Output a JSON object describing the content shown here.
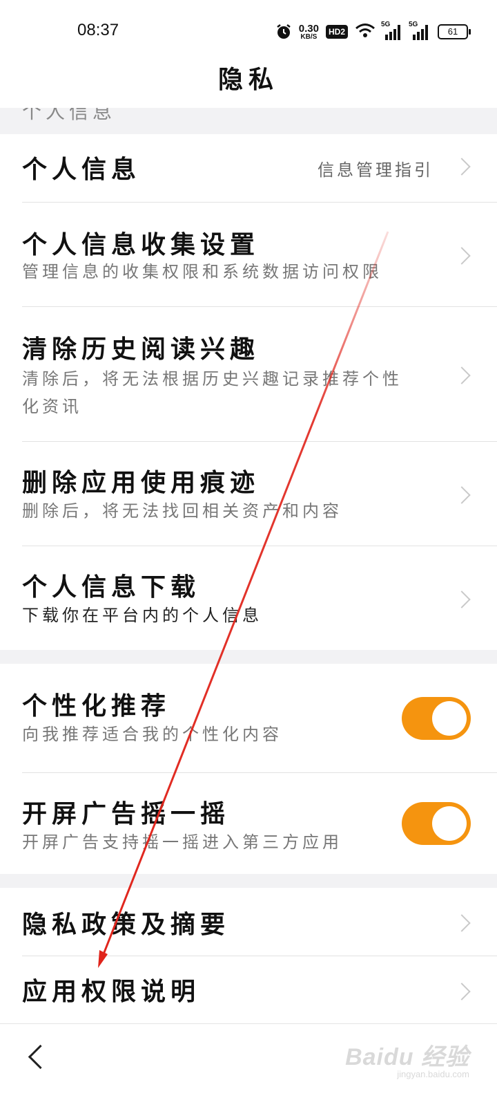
{
  "status_bar": {
    "time": "08:37",
    "net_speed_value": "0.30",
    "net_speed_unit": "KB/S",
    "hd_badge": "HD2",
    "signal1_label": "5G",
    "signal2_label": "5G",
    "battery": "61"
  },
  "header": {
    "title": "隐私"
  },
  "partial_section_header": "个人信息",
  "items": {
    "personal_info": {
      "title": "个人信息",
      "hint": "信息管理指引"
    },
    "collect_settings": {
      "title": "个人信息收集设置",
      "subtitle": "管理信息的收集权限和系统数据访问权限"
    },
    "clear_interest": {
      "title": "清除历史阅读兴趣",
      "subtitle": "清除后，将无法根据历史兴趣记录推荐个性化资讯"
    },
    "delete_traces": {
      "title": "删除应用使用痕迹",
      "subtitle": "删除后，将无法找回相关资产和内容"
    },
    "download_info": {
      "title": "个人信息下载",
      "subtitle": "下载你在平台内的个人信息"
    },
    "personalized": {
      "title": "个性化推荐",
      "subtitle": "向我推荐适合我的个性化内容",
      "enabled": true
    },
    "shake_ad": {
      "title": "开屏广告摇一摇",
      "subtitle": "开屏广告支持摇一摇进入第三方应用",
      "enabled": true
    },
    "privacy_policy": {
      "title": "隐私政策及摘要"
    },
    "permissions": {
      "title": "应用权限说明"
    }
  },
  "watermark": {
    "text": "Baidu 经验",
    "url": "jingyan.baidu.com"
  },
  "colors": {
    "accent": "#f5940f",
    "annotation_arrow": "#e0241b",
    "section_bg": "#f2f2f4"
  }
}
